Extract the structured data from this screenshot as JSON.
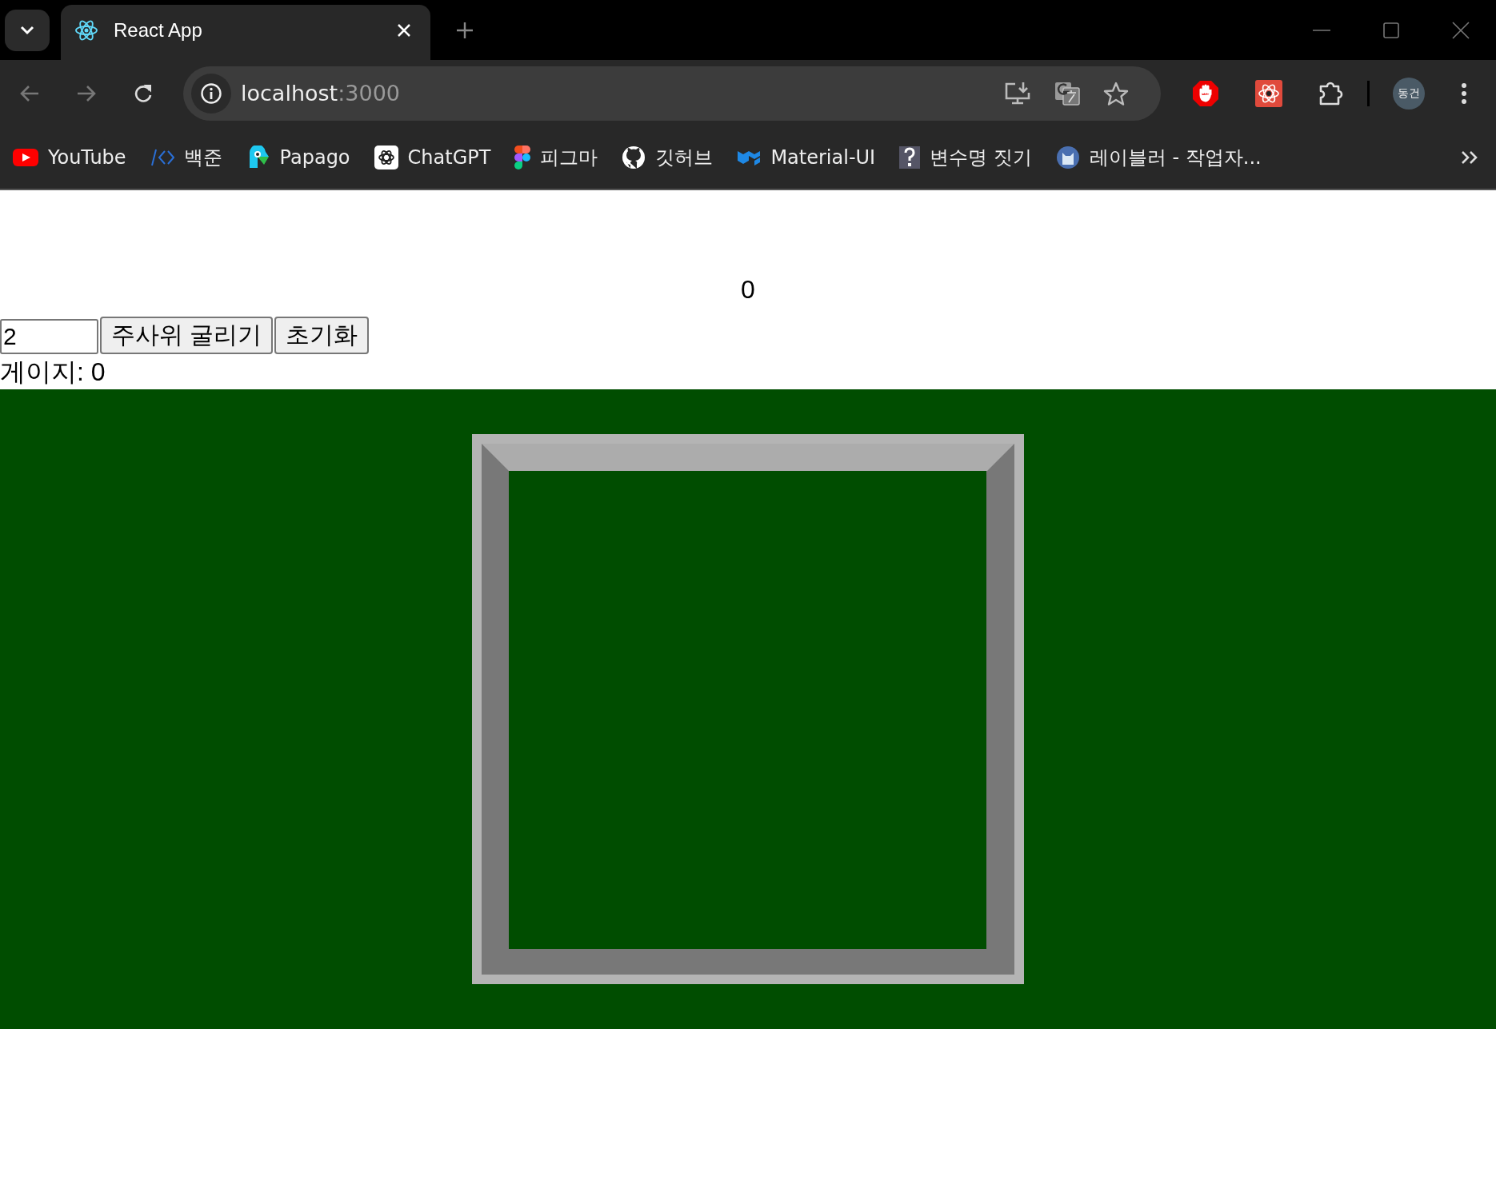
{
  "browser": {
    "tab": {
      "title": "React App"
    },
    "address": {
      "host": "localhost",
      "port": ":3000"
    },
    "profile": "동건",
    "bookmarks": [
      {
        "label": "YouTube",
        "kind": "youtube"
      },
      {
        "label": "백준",
        "kind": "code"
      },
      {
        "label": "Papago",
        "kind": "papago"
      },
      {
        "label": "ChatGPT",
        "kind": "chatgpt"
      },
      {
        "label": "피그마",
        "kind": "figma"
      },
      {
        "label": "깃허브",
        "kind": "github"
      },
      {
        "label": "Material-UI",
        "kind": "mui"
      },
      {
        "label": "변수명 짓기",
        "kind": "question"
      },
      {
        "label": "레이블러 - 작업자...",
        "kind": "cat"
      }
    ]
  },
  "page": {
    "counter": "0",
    "dice_input": {
      "value": "2"
    },
    "buttons": [
      "주사위 굴리기",
      "초기화"
    ],
    "gauge": "게이지: 0"
  }
}
